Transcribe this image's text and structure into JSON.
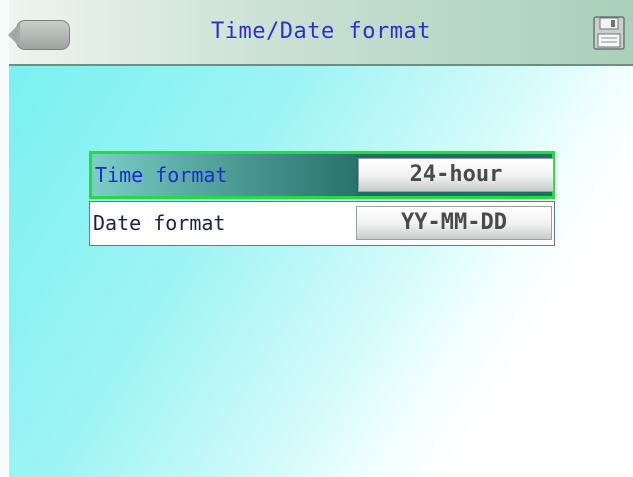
{
  "header": {
    "title": "Time/Date format",
    "back_icon": "back-icon",
    "save_icon": "save-icon"
  },
  "settings": [
    {
      "label": "Time format",
      "value": "24-hour",
      "selected": true
    },
    {
      "label": "Date format",
      "value": "YY-MM-DD",
      "selected": false
    }
  ],
  "colors": {
    "title_text": "#2c2fd4",
    "selection_border": "#22dd3a",
    "selected_row": "#1f6e68",
    "background": "#74f0f0"
  }
}
